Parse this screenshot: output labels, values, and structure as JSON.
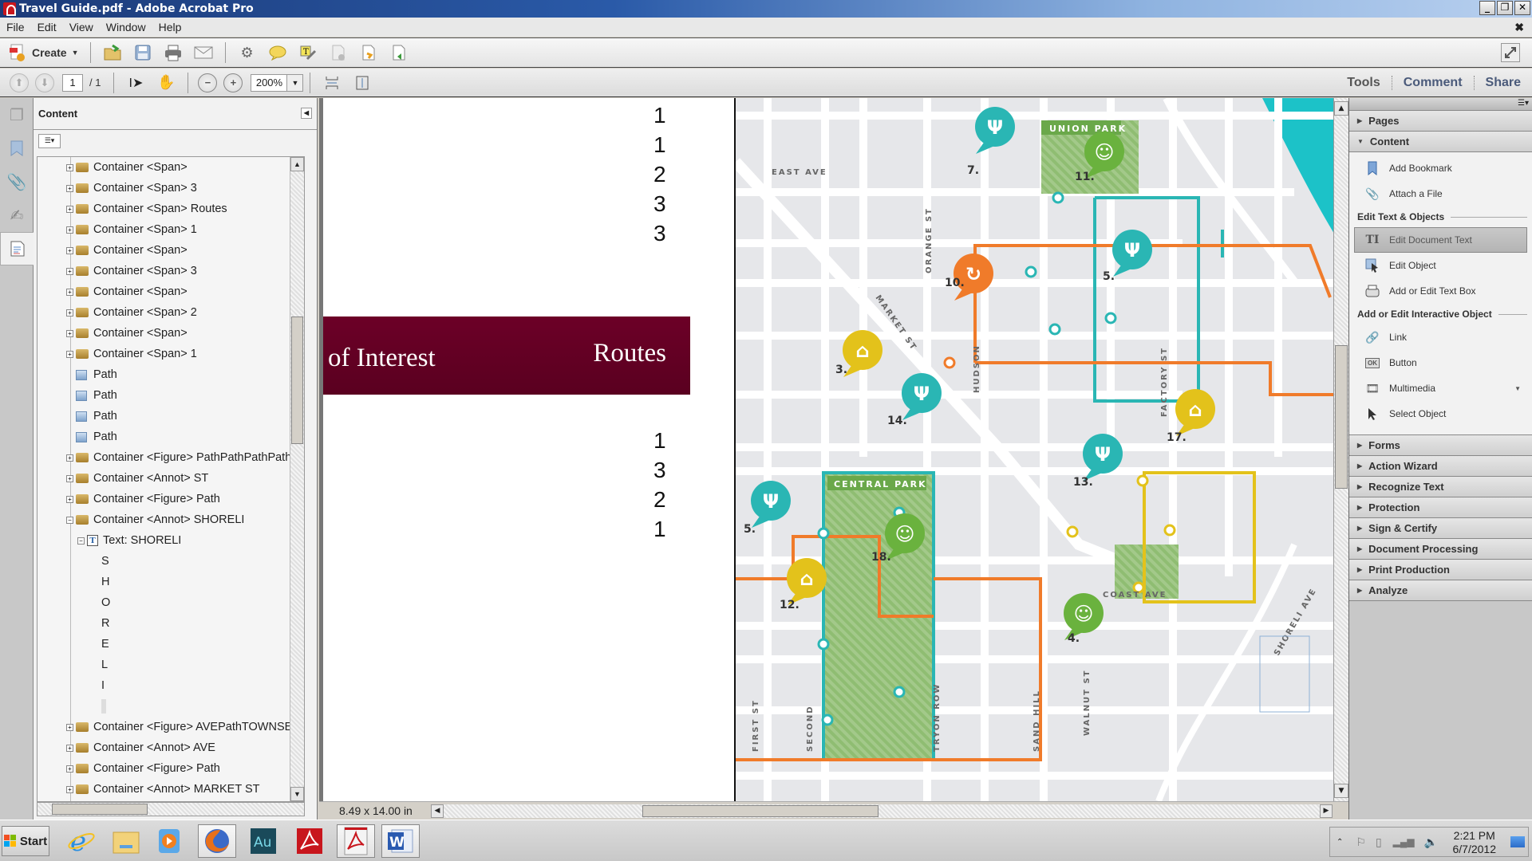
{
  "window": {
    "title": "Travel Guide.pdf - Adobe Acrobat Pro",
    "controls": [
      "_",
      "❐",
      "✕"
    ]
  },
  "menu": [
    "File",
    "Edit",
    "View",
    "Window",
    "Help"
  ],
  "toolbar": {
    "create_label": "Create",
    "icons": [
      "open-icon",
      "save-icon",
      "print-icon",
      "email-icon",
      "settings-icon",
      "comment-icon",
      "highlight-icon",
      "remove-page-icon",
      "export-icon",
      "share-icon"
    ]
  },
  "navbar": {
    "page_current": "1",
    "page_total": "/ 1",
    "zoom": "200%"
  },
  "panel_links": {
    "tools": "Tools",
    "comment": "Comment",
    "share": "Share"
  },
  "content_panel": {
    "title": "Content",
    "tree": [
      {
        "type": "container",
        "label": "Container <Span>",
        "level": 1,
        "state": "+"
      },
      {
        "type": "container",
        "label": "Container <Span> 3",
        "level": 1,
        "state": "+"
      },
      {
        "type": "container",
        "label": "Container <Span> Routes",
        "level": 1,
        "state": "+"
      },
      {
        "type": "container",
        "label": "Container <Span> 1",
        "level": 1,
        "state": "+"
      },
      {
        "type": "container",
        "label": "Container <Span>",
        "level": 1,
        "state": "+"
      },
      {
        "type": "container",
        "label": "Container <Span> 3",
        "level": 1,
        "state": "+"
      },
      {
        "type": "container",
        "label": "Container <Span>",
        "level": 1,
        "state": "+"
      },
      {
        "type": "container",
        "label": "Container <Span> 2",
        "level": 1,
        "state": "+"
      },
      {
        "type": "container",
        "label": "Container <Span>",
        "level": 1,
        "state": "+"
      },
      {
        "type": "container",
        "label": "Container <Span> 1",
        "level": 1,
        "state": "+"
      },
      {
        "type": "path",
        "label": "Path",
        "level": 1
      },
      {
        "type": "path",
        "label": "Path",
        "level": 1
      },
      {
        "type": "path",
        "label": "Path",
        "level": 1
      },
      {
        "type": "path",
        "label": "Path",
        "level": 1
      },
      {
        "type": "container",
        "label": "Container <Figure> PathPathPathPathP",
        "level": 1,
        "state": "+"
      },
      {
        "type": "container",
        "label": "Container <Annot> ST",
        "level": 1,
        "state": "+"
      },
      {
        "type": "container",
        "label": "Container <Figure> Path",
        "level": 1,
        "state": "+"
      },
      {
        "type": "container",
        "label": "Container <Annot> SHORELI",
        "level": 1,
        "state": "−"
      },
      {
        "type": "text",
        "label": "Text: SHORELI",
        "level": 2,
        "state": "−"
      },
      {
        "type": "char",
        "label": "S",
        "level": 3
      },
      {
        "type": "char",
        "label": "H",
        "level": 3
      },
      {
        "type": "char",
        "label": "O",
        "level": 3
      },
      {
        "type": "char",
        "label": "R",
        "level": 3
      },
      {
        "type": "char",
        "label": "E",
        "level": 3
      },
      {
        "type": "char",
        "label": "L",
        "level": 3
      },
      {
        "type": "char",
        "label": "I",
        "level": 3
      },
      {
        "type": "char",
        "label": "",
        "level": 3
      },
      {
        "type": "container",
        "label": "Container <Figure> AVEPathTOWNSEN",
        "level": 1,
        "state": "+"
      },
      {
        "type": "container",
        "label": "Container <Annot> AVE",
        "level": 1,
        "state": "+"
      },
      {
        "type": "container",
        "label": "Container <Figure> Path",
        "level": 1,
        "state": "+"
      },
      {
        "type": "container",
        "label": "Container <Annot> MARKET ST",
        "level": 1,
        "state": "+"
      }
    ]
  },
  "document": {
    "numbers_top": [
      "1",
      "1",
      "2",
      "3",
      "3"
    ],
    "banner_left": "of Interest",
    "banner_right": "Routes",
    "numbers_bottom": [
      "1",
      "3",
      "2",
      "1"
    ],
    "page_size": "8.49 x 14.00 in",
    "map": {
      "streets": [
        "EAST AVE",
        "ORANGE ST",
        "MARKET ST",
        "HUDSON",
        "FACTORY ST",
        "COAST AVE",
        "FIRST ST",
        "SECOND",
        "TRYON ROW",
        "SAND HILL",
        "WALNUT ST",
        "SHORELI AVE"
      ],
      "parks": [
        "UNION PARK",
        "CENTRAL PARK"
      ],
      "markers": [
        {
          "num": "7.",
          "kind": "food"
        },
        {
          "num": "11.",
          "kind": "park"
        },
        {
          "num": "5.",
          "kind": "food"
        },
        {
          "num": "10.",
          "kind": "bike"
        },
        {
          "num": "3.",
          "kind": "lodging"
        },
        {
          "num": "14.",
          "kind": "food"
        },
        {
          "num": "17.",
          "kind": "lodging"
        },
        {
          "num": "13.",
          "kind": "food"
        },
        {
          "num": "5.",
          "kind": "food"
        },
        {
          "num": "18.",
          "kind": "park"
        },
        {
          "num": "12.",
          "kind": "lodging"
        },
        {
          "num": "4.",
          "kind": "park"
        }
      ],
      "colors": {
        "teal": "#2ab6b4",
        "orange": "#f07b2a",
        "yellow": "#e3c21b",
        "green": "#6ab23e",
        "road": "#ffffff",
        "block": "#e6e7ea",
        "water": "#1cc2c8"
      }
    }
  },
  "tools_panel": {
    "sections_top": [
      {
        "label": "Pages",
        "open": false
      },
      {
        "label": "Content",
        "open": true
      }
    ],
    "content_items": [
      {
        "label": "Add Bookmark",
        "icon": "bookmark-icon"
      },
      {
        "label": "Attach a File",
        "icon": "paperclip-icon"
      }
    ],
    "edit_heading": "Edit Text & Objects",
    "edit_items": [
      {
        "label": "Edit Document Text",
        "icon": "text-cursor-icon",
        "selected": true
      },
      {
        "label": "Edit Object",
        "icon": "edit-object-icon"
      },
      {
        "label": "Add or Edit Text Box",
        "icon": "typewriter-icon"
      }
    ],
    "interactive_heading": "Add or Edit Interactive Object",
    "interactive_items": [
      {
        "label": "Link",
        "icon": "link-icon"
      },
      {
        "label": "Button",
        "icon": "ok-button-icon"
      },
      {
        "label": "Multimedia",
        "icon": "multimedia-icon",
        "dropdown": true
      },
      {
        "label": "Select Object",
        "icon": "arrow-cursor-icon"
      }
    ],
    "sections_bottom": [
      "Forms",
      "Action Wizard",
      "Recognize Text",
      "Protection",
      "Sign & Certify",
      "Document Processing",
      "Print Production",
      "Analyze"
    ]
  },
  "taskbar": {
    "start_label": "Start",
    "apps": [
      "internet-explorer",
      "file-explorer",
      "media-player",
      "firefox",
      "audition",
      "acrobat",
      "acrobat-active",
      "word"
    ],
    "time": "2:21 PM",
    "date": "6/7/2012"
  }
}
